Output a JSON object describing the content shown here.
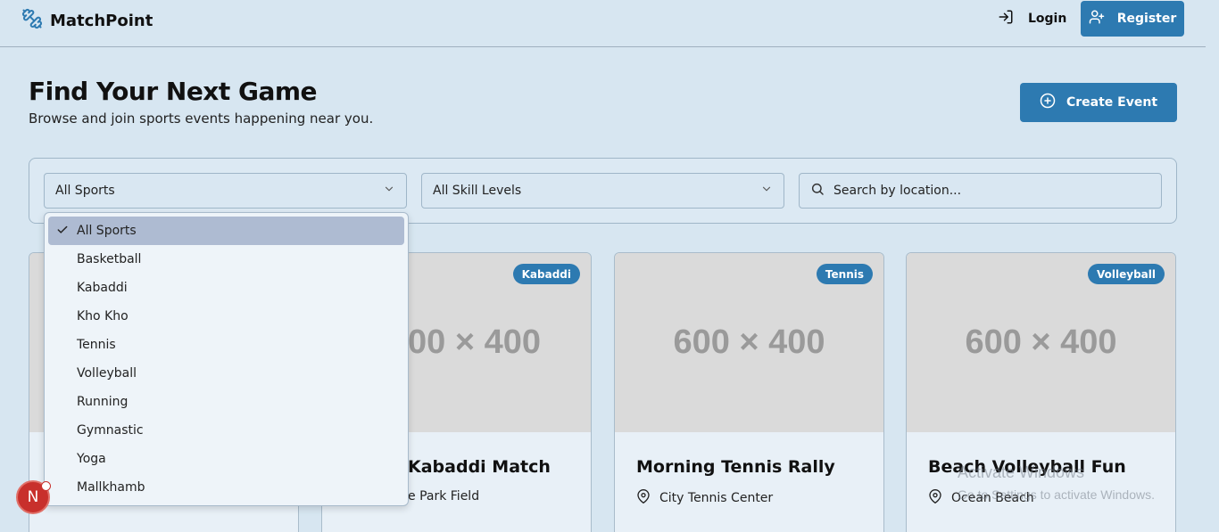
{
  "brand": {
    "name": "MatchPoint",
    "logo_icon": "dumbbell-icon"
  },
  "nav": {
    "login_label": "Login",
    "register_label": "Register"
  },
  "header": {
    "title": "Find Your Next Game",
    "subtitle": "Browse and join sports events happening near you.",
    "create_label": "Create Event"
  },
  "filters": {
    "sport_selected": "All Sports",
    "skill_selected": "All Skill Levels",
    "location_placeholder": "Search by location..."
  },
  "sport_options": [
    {
      "label": "All Sports",
      "selected": true
    },
    {
      "label": "Basketball"
    },
    {
      "label": "Kabaddi"
    },
    {
      "label": "Kho Kho"
    },
    {
      "label": "Tennis"
    },
    {
      "label": "Volleyball"
    },
    {
      "label": "Running"
    },
    {
      "label": "Gymnastic"
    },
    {
      "label": "Yoga"
    },
    {
      "label": "Mallkhamb"
    }
  ],
  "events": [
    {
      "image_text": "",
      "badge": "",
      "title": "",
      "location": ""
    },
    {
      "image_text": "00 × 400",
      "badge": "Kabaddi",
      "title": "Kabaddi Match",
      "location": "e Park Field"
    },
    {
      "image_text": "600 × 400",
      "badge": "Tennis",
      "title": "Morning Tennis Rally",
      "location": "City Tennis Center"
    },
    {
      "image_text": "600 × 400",
      "badge": "Volleyball",
      "title": "Beach Volleyball Fun",
      "location": "Ocean Beach"
    }
  ],
  "user": {
    "initial": "N"
  },
  "watermark": {
    "line1": "Activate Windows",
    "line2": "Go to Settings to activate Windows."
  },
  "colors": {
    "accent": "#2d7ab1",
    "background": "#d7e6f1",
    "avatar": "#c8302c"
  }
}
